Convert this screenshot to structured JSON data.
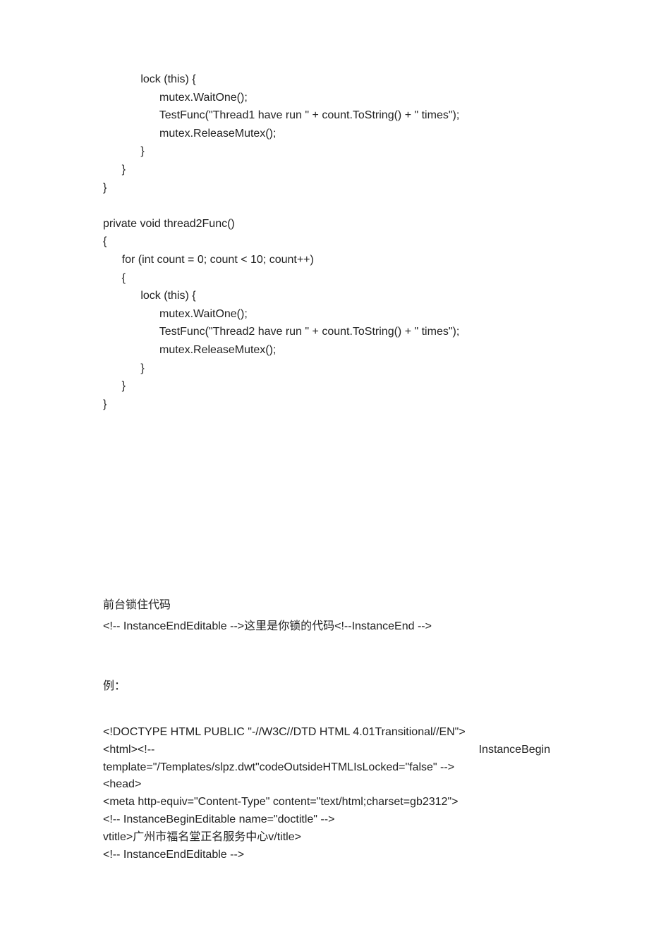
{
  "code": {
    "lines": [
      "            lock (this) {",
      "                  mutex.WaitOne();",
      "                  TestFunc(\"Thread1 have run \" + count.ToString() + \" times\");",
      "                  mutex.ReleaseMutex();",
      "            }",
      "      }",
      "}",
      "",
      "private void thread2Func()",
      "{",
      "      for (int count = 0; count < 10; count++)",
      "      {",
      "            lock (this) {",
      "                  mutex.WaitOne();",
      "                  TestFunc(\"Thread2 have run \" + count.ToString() + \" times\");",
      "                  mutex.ReleaseMutex();",
      "            }",
      "      }",
      "}"
    ]
  },
  "section": {
    "title": "前台锁住代码",
    "comment_prefix": "<!-- InstanceEndEditable -->",
    "comment_mid": "这里是你锁的代码",
    "comment_suffix": "<!--InstanceEnd -->"
  },
  "example": {
    "label": "例：",
    "lines": {
      "l1": "<!DOCTYPE HTML PUBLIC \"-//W3C//DTD HTML 4.01Transitional//EN\">",
      "l2_left": "<html><!--",
      "l2_right": "InstanceBegin",
      "l3": "template=\"/Templates/slpz.dwt\"codeOutsideHTMLIsLocked=\"false\" -->",
      "l4": "<head>",
      "l5": "<meta http-equiv=\"Content-Type\" content=\"text/html;charset=gb2312\">",
      "l6": "<!-- InstanceBeginEditable name=\"doctitle\" -->",
      "l7": "vtitle>广州市福名堂正名服务中心v/title>",
      "l8": "<!-- InstanceEndEditable -->"
    }
  }
}
